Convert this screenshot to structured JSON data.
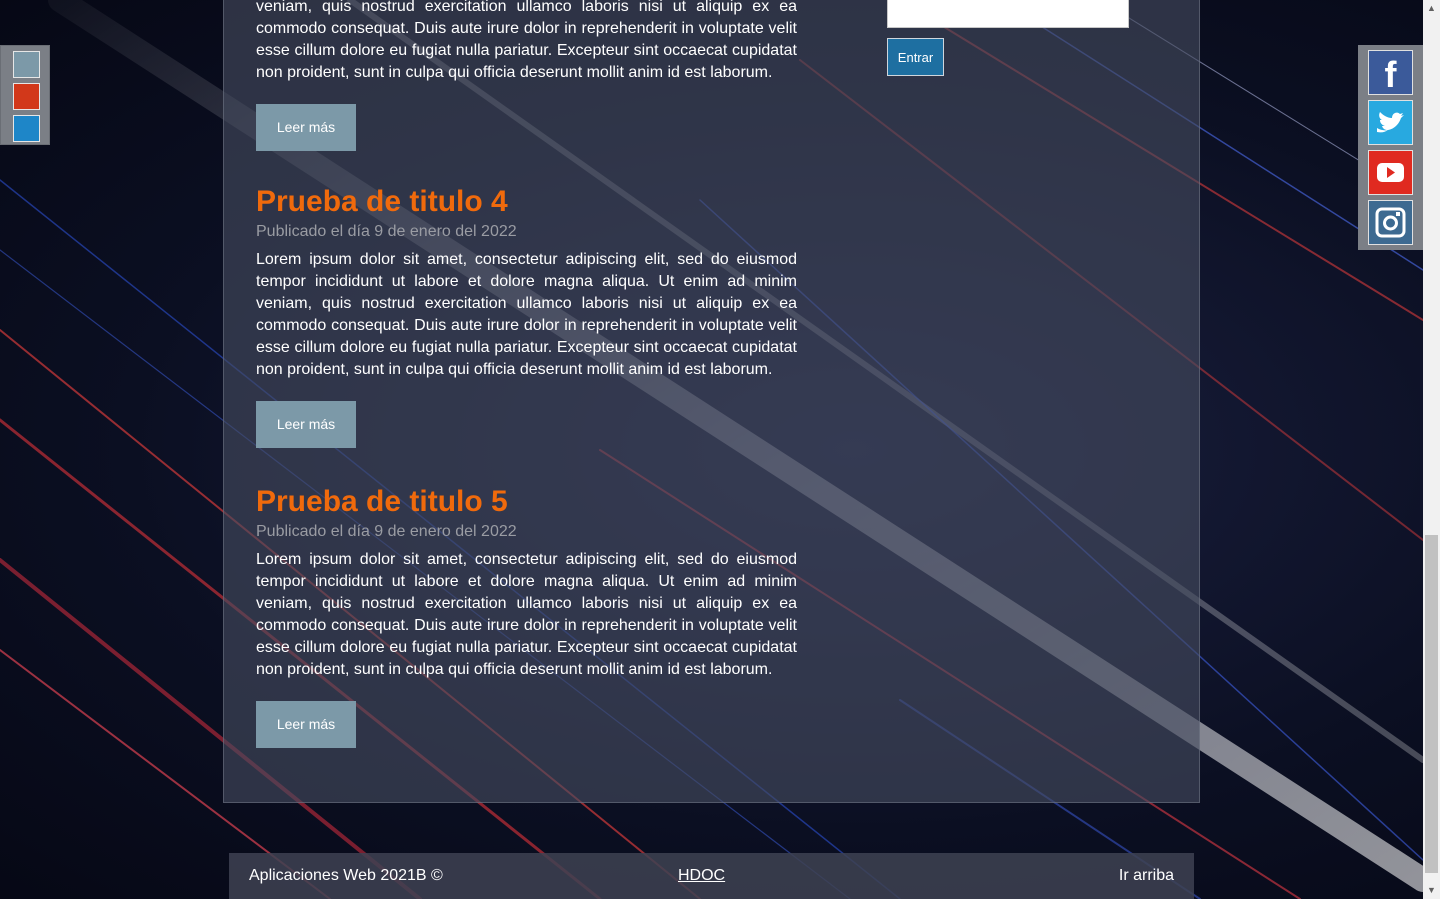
{
  "posts": [
    {
      "text": "veniam, quis nostrud exercitation ullamco laboris nisi ut aliquip ex ea commodo consequat. Duis aute irure dolor in reprehenderit in voluptate velit esse cillum dolore eu fugiat nulla pariatur. Excepteur sint occaecat cupidatat non proident, sunt in culpa qui officia deserunt mollit anim id est laborum.",
      "button": "Leer más"
    },
    {
      "title": "Prueba de titulo 4",
      "date": "Publicado el día 9 de enero del 2022",
      "text": "Lorem ipsum dolor sit amet, consectetur adipiscing elit, sed do eiusmod tempor incididunt ut labore et dolore magna aliqua. Ut enim ad minim veniam, quis nostrud exercitation ullamco laboris nisi ut aliquip ex ea commodo consequat. Duis aute irure dolor in reprehenderit in voluptate velit esse cillum dolore eu fugiat nulla pariatur. Excepteur sint occaecat cupidatat non proident, sunt in culpa qui officia deserunt mollit anim id est laborum.",
      "button": "Leer más"
    },
    {
      "title": "Prueba de titulo 5",
      "date": "Publicado el día 9 de enero del 2022",
      "text": "Lorem ipsum dolor sit amet, consectetur adipiscing elit, sed do eiusmod tempor incididunt ut labore et dolore magna aliqua. Ut enim ad minim veniam, quis nostrud exercitation ullamco laboris nisi ut aliquip ex ea commodo consequat. Duis aute irure dolor in reprehenderit in voluptate velit esse cillum dolore eu fugiat nulla pariatur. Excepteur sint occaecat cupidatat non proident, sunt in culpa qui officia deserunt mollit anim id est laborum.",
      "button": "Leer más"
    }
  ],
  "login": {
    "submit": "Entrar",
    "input_value": ""
  },
  "themes": [
    {
      "color": "#7c99a8"
    },
    {
      "color": "#d2381a"
    },
    {
      "color": "#1e86c8"
    }
  ],
  "social": [
    {
      "name": "facebook-icon",
      "color": "#3b5a9a"
    },
    {
      "name": "twitter-icon",
      "color": "#28a9e0"
    },
    {
      "name": "youtube-icon",
      "color": "#e02a20"
    },
    {
      "name": "instagram-icon",
      "color": "#3d6a91"
    }
  ],
  "footer": {
    "copyright": "Aplicaciones Web 2021B ©",
    "link": "HDOC",
    "top": "Ir arriba"
  },
  "colors": {
    "title": "#f06a0c",
    "button": "#7c99a8",
    "login_button": "#1e6fa1"
  }
}
